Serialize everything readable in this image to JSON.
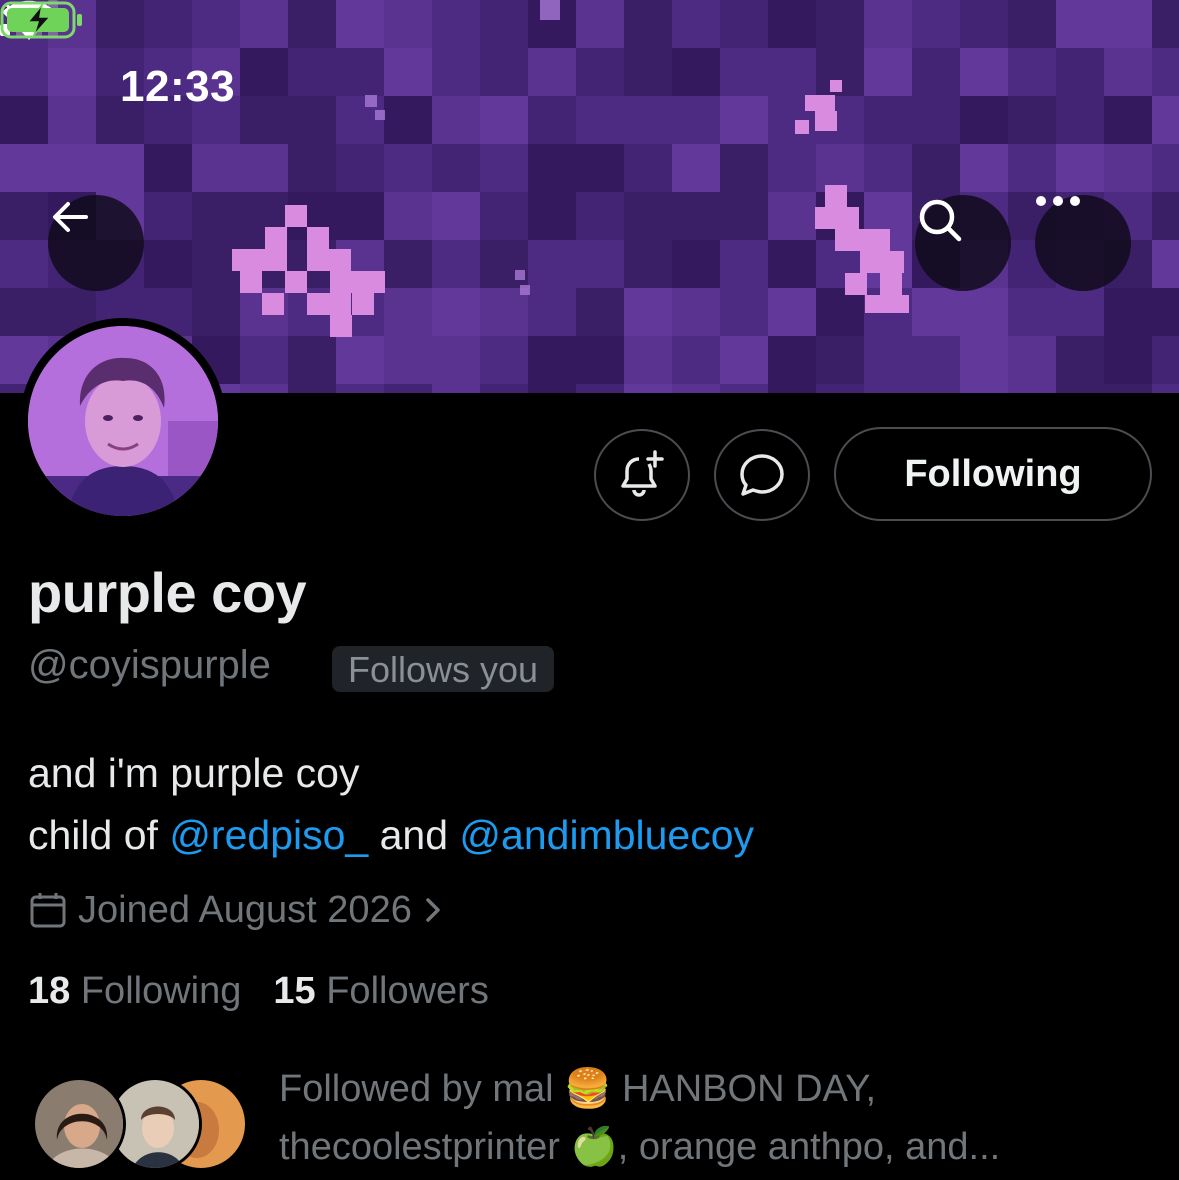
{
  "status_bar": {
    "time": "12:33"
  },
  "header": {
    "back_icon": "arrow-left-icon",
    "search_icon": "search-icon",
    "more_icon": "more-horizontal-icon"
  },
  "actions": {
    "notify_icon": "bell-plus-icon",
    "message_icon": "chat-bubble-icon",
    "following_label": "Following"
  },
  "profile": {
    "display_name": "purple coy",
    "handle": "@coyispurple",
    "follows_you_badge": "Follows you",
    "bio_line1": "and i'm purple coy",
    "bio_prefix": "child of ",
    "bio_mention1": "@redpiso_",
    "bio_and": " and ",
    "bio_mention2": "@andimbluecoy",
    "joined": "Joined August 2026",
    "following_count": "18",
    "following_label": "Following",
    "followers_count": "15",
    "followers_label": "Followers",
    "followed_by_line1": "Followed by mal 🍔 HANBON DAY,",
    "followed_by_line2": "thecoolestprinter 🍏, orange anthpo, and..."
  },
  "colors": {
    "accent": "#1d9bf0",
    "banner": "#3a1f66",
    "muted": "#71767b"
  }
}
